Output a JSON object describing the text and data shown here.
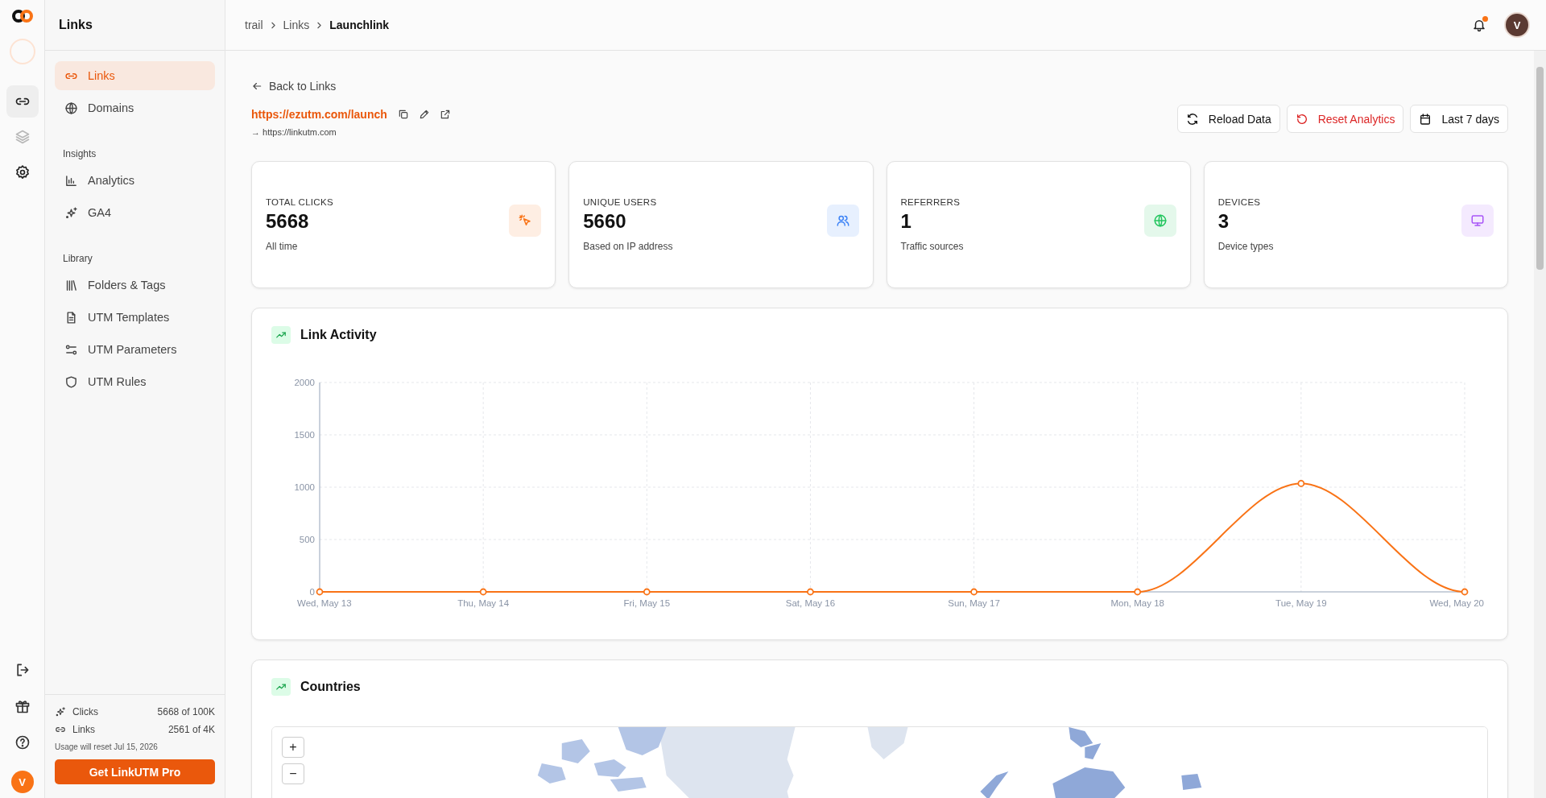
{
  "rail": {
    "items": [
      {
        "selected": true,
        "disabled": false
      },
      {
        "selected": false,
        "disabled": true
      },
      {
        "selected": false,
        "disabled": false
      }
    ],
    "avatar": "V"
  },
  "sidebar": {
    "title": "Links",
    "sections": [
      {
        "items": [
          {
            "label": "Links",
            "selected": true
          },
          {
            "label": "Domains",
            "selected": false
          }
        ]
      },
      {
        "heading": "Insights",
        "items": [
          {
            "label": "Analytics",
            "selected": false
          },
          {
            "label": "GA4",
            "selected": false
          }
        ]
      },
      {
        "heading": "Library",
        "items": [
          {
            "label": "Folders & Tags",
            "selected": false
          },
          {
            "label": "UTM Templates",
            "selected": false
          },
          {
            "label": "UTM Parameters",
            "selected": false
          },
          {
            "label": "UTM Rules",
            "selected": false
          }
        ]
      }
    ],
    "usage": [
      {
        "label": "Clicks",
        "value": "5668 of 100K"
      },
      {
        "label": "Links",
        "value": "2561 of 4K"
      }
    ],
    "usage_note": "Usage will reset Jul 15, 2026",
    "upgrade_button": "Get LinkUTM Pro"
  },
  "header": {
    "breadcrumbs": [
      "trail",
      "Links",
      "Launchlink"
    ],
    "notifications_unread": true,
    "avatar": "V"
  },
  "link": {
    "back": "Back to Links",
    "short_url": "https://ezutm.com/launch",
    "destination": "→ https://linkutm.com"
  },
  "actions": [
    {
      "label": "Reload Data",
      "kind": "default"
    },
    {
      "label": "Reset Analytics",
      "kind": "danger"
    },
    {
      "label": "Last 7 days",
      "kind": "default"
    }
  ],
  "stats": [
    {
      "title": "TOTAL CLICKS",
      "value": "5668",
      "caption": "All time",
      "color": "#f97316"
    },
    {
      "title": "UNIQUE USERS",
      "value": "5660",
      "caption": "Based on IP address",
      "color": "#3b82f6"
    },
    {
      "title": "REFERRERS",
      "value": "1",
      "caption": "Traffic sources",
      "color": "#22c55e"
    },
    {
      "title": "DEVICES",
      "value": "3",
      "caption": "Device types",
      "color": "#a855f7"
    }
  ],
  "activity": {
    "title": "Link Activity",
    "chart_data": {
      "type": "line",
      "categories": [
        "Wed, May 13",
        "Thu, May 14",
        "Fri, May 15",
        "Sat, May 16",
        "Sun, May 17",
        "Mon, May 18",
        "Tue, May 19",
        "Wed, May 20"
      ],
      "series": [
        {
          "color": "#f97316",
          "marker": "circle",
          "values": [
            0,
            0,
            0,
            0,
            0,
            0,
            1035,
            0
          ]
        }
      ],
      "ylim": [
        0,
        2000
      ],
      "yticks": [
        0,
        500,
        1000,
        1500,
        2000
      ],
      "grid": true
    }
  },
  "countries": {
    "title": "Countries",
    "zoom_buttons": [
      "+",
      "−"
    ]
  }
}
